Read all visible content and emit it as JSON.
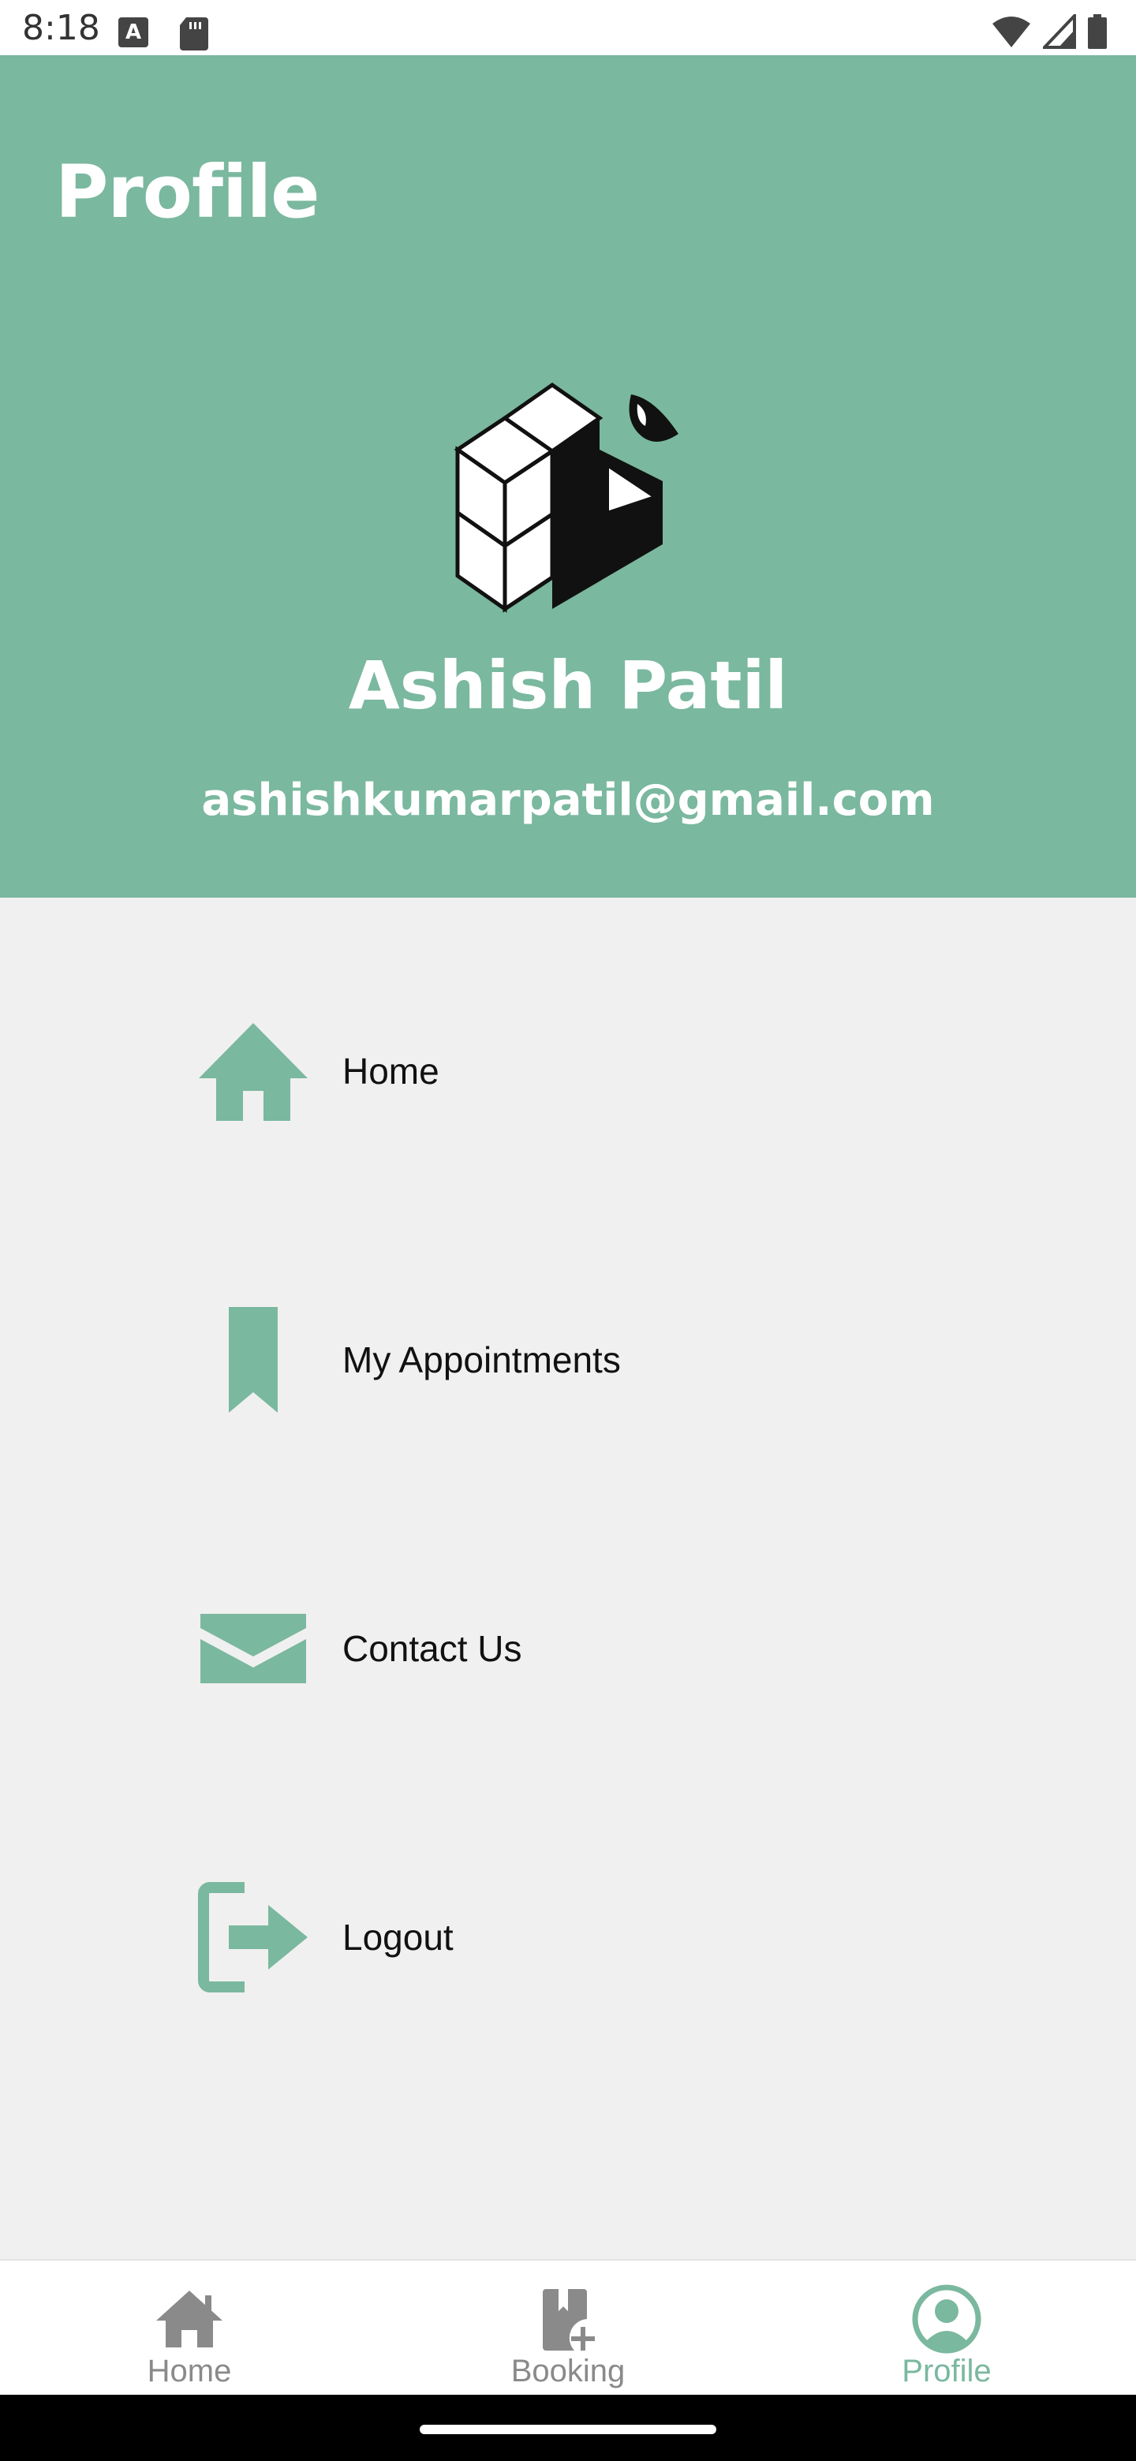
{
  "status_bar": {
    "time": "8:18",
    "notification_icon_letter": "A",
    "icons": [
      "text-notification-icon",
      "sd-card-icon",
      "wifi-icon",
      "signal-icon",
      "battery-icon"
    ]
  },
  "header": {
    "title": "Profile",
    "background_color": "#7ab89f",
    "avatar_icon": "cube-logo-icon"
  },
  "user": {
    "name": "Ashish Patil",
    "email": "ashishkumarpatil@gmail.com"
  },
  "menu": {
    "items": [
      {
        "label": "Home",
        "icon": "home-icon"
      },
      {
        "label": "My Appointments",
        "icon": "bookmark-icon"
      },
      {
        "label": "Contact Us",
        "icon": "envelope-icon"
      },
      {
        "label": "Logout",
        "icon": "logout-icon"
      }
    ]
  },
  "bottom_nav": {
    "items": [
      {
        "label": "Home",
        "icon": "home-icon",
        "active": false
      },
      {
        "label": "Booking",
        "icon": "booking-add-icon",
        "active": false
      },
      {
        "label": "Profile",
        "icon": "profile-icon",
        "active": true
      }
    ]
  },
  "colors": {
    "accent": "#7ab89f",
    "inactive": "#8a8a8a",
    "background": "#f0f0f0"
  }
}
